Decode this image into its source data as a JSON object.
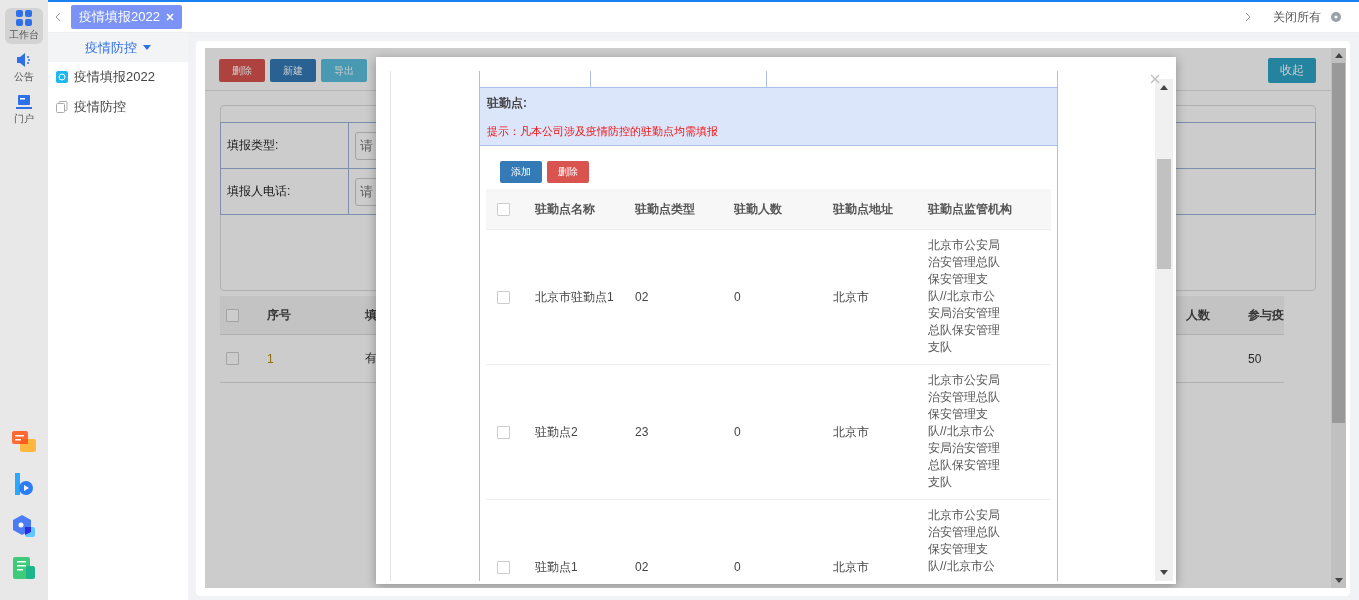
{
  "rail": {
    "items": [
      {
        "label": "工作台",
        "kind": "grid",
        "selected": true
      },
      {
        "label": "公告",
        "kind": "speaker",
        "selected": false
      },
      {
        "label": "门户",
        "kind": "monitor",
        "selected": false
      }
    ],
    "apps": [
      {
        "kind": "chat"
      },
      {
        "kind": "letter"
      },
      {
        "kind": "hexagon"
      },
      {
        "kind": "document"
      }
    ]
  },
  "tabs": [
    {
      "label": "疫情填报2022",
      "selected": true
    }
  ],
  "close_all": "关闭所有",
  "sidebar": {
    "title": "疫情防控",
    "items": [
      {
        "label": "疫情填报2022",
        "kind": "app"
      },
      {
        "label": "疫情防控",
        "kind": "page"
      }
    ]
  },
  "page": {
    "toolbar": [
      {
        "label": "删除",
        "kind": "danger"
      },
      {
        "label": "新建",
        "kind": "primary"
      },
      {
        "label": "导出",
        "kind": "info"
      }
    ],
    "collapse_button": "收起",
    "filters": [
      {
        "label": "填报类型:",
        "placeholder": "请"
      },
      {
        "label": "填报人电话:",
        "placeholder": "请"
      }
    ],
    "table": {
      "header_checked": false,
      "columns": [
        "序号",
        "填",
        "人数",
        "参与疫"
      ],
      "rows": [
        {
          "checked": false,
          "number": "1",
          "column_2": "有",
          "column_4": "50"
        }
      ]
    }
  },
  "dialog": {
    "section_title": "驻勤点:",
    "hint": "提示：凡本公司涉及疫情防控的驻勤点均需填报",
    "buttons": [
      {
        "label": "添加",
        "kind": "primary"
      },
      {
        "label": "删除",
        "kind": "danger"
      }
    ],
    "header_checked": false,
    "columns": [
      "驻勤点名称",
      "驻勤点类型",
      "驻勤人数",
      "驻勤点地址",
      "驻勤点监管机构"
    ],
    "rows": [
      {
        "checked": false,
        "name": "北京市驻勤点1",
        "type": "02",
        "count": "0",
        "address": "北京市",
        "authority": "北京市公安局治安管理总队保安管理支队//北京市公安局治安管理总队保安管理支队"
      },
      {
        "checked": false,
        "name": "驻勤点2",
        "type": "23",
        "count": "0",
        "address": "北京市",
        "authority": "北京市公安局治安管理总队保安管理支队//北京市公安局治安管理总队保安管理支队"
      },
      {
        "checked": false,
        "name": "驻勤点1",
        "type": "02",
        "count": "0",
        "address": "北京市",
        "authority": "北京市公安局治安管理总队保安管理支队//北京市公"
      }
    ]
  }
}
